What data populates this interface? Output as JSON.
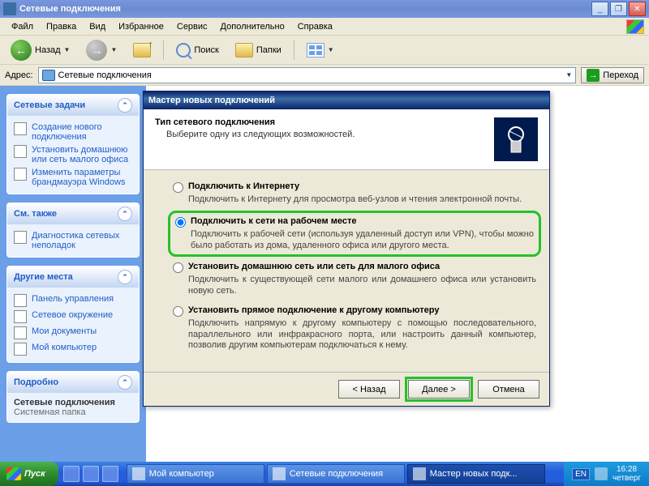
{
  "window": {
    "title": "Сетевые подключения",
    "min": "_",
    "max": "▭",
    "restore": "❐",
    "close": "✕"
  },
  "menu": {
    "file": "Файл",
    "edit": "Правка",
    "view": "Вид",
    "favorites": "Избранное",
    "service": "Сервис",
    "extra": "Дополнительно",
    "help": "Справка"
  },
  "toolbar": {
    "back": "Назад",
    "search": "Поиск",
    "folders": "Папки"
  },
  "address": {
    "label": "Адрес:",
    "value": "Сетевые подключения",
    "go": "Переход"
  },
  "side": {
    "tasks_hdr": "Сетевые задачи",
    "task_create": "Создание нового подключения",
    "task_home": "Установить домашнюю или сеть малого офиса",
    "task_firewall": "Изменить параметры брандмауэра Windows",
    "see_hdr": "См. также",
    "see_diag": "Диагностика сетевых неполадок",
    "other_hdr": "Другие места",
    "other_cp": "Панель управления",
    "other_nh": "Сетевое окружение",
    "other_docs": "Мои документы",
    "other_comp": "Мой компьютер",
    "details_hdr": "Подробно",
    "details_t": "Сетевые подключения",
    "details_s": "Системная папка"
  },
  "wizard": {
    "title": "Мастер новых подключений",
    "h_title": "Тип сетевого подключения",
    "h_sub": "Выберите одну из следующих возможностей.",
    "opts": [
      {
        "label": "Подключить к Интернету",
        "desc": "Подключить к Интернету для просмотра веб-узлов и чтения электронной почты."
      },
      {
        "label": "Подключить к сети на рабочем месте",
        "desc": "Подключить к рабочей сети (используя удаленный доступ или VPN), чтобы можно было работать из дома, удаленного офиса или другого места."
      },
      {
        "label": "Установить домашнюю сеть или сеть для малого офиса",
        "desc": "Подключить к существующей сети малого или домашнего офиса или установить новую сеть."
      },
      {
        "label": "Установить прямое подключение к другому компьютеру",
        "desc": "Подключить напрямую к другому компьютеру с помощью последовательного, параллельного или инфракрасного порта, или настроить данный компьютер, позволив другим компьютерам подключаться к нему."
      }
    ],
    "btn_back": "< Назад",
    "btn_next": "Далее >",
    "btn_cancel": "Отмена",
    "selected": 1
  },
  "taskbar": {
    "start": "Пуск",
    "tasks": [
      "Мой компьютер",
      "Сетевые подключения",
      "Мастер новых подк..."
    ],
    "lang": "EN",
    "time": "16:28",
    "day": "четверг"
  }
}
